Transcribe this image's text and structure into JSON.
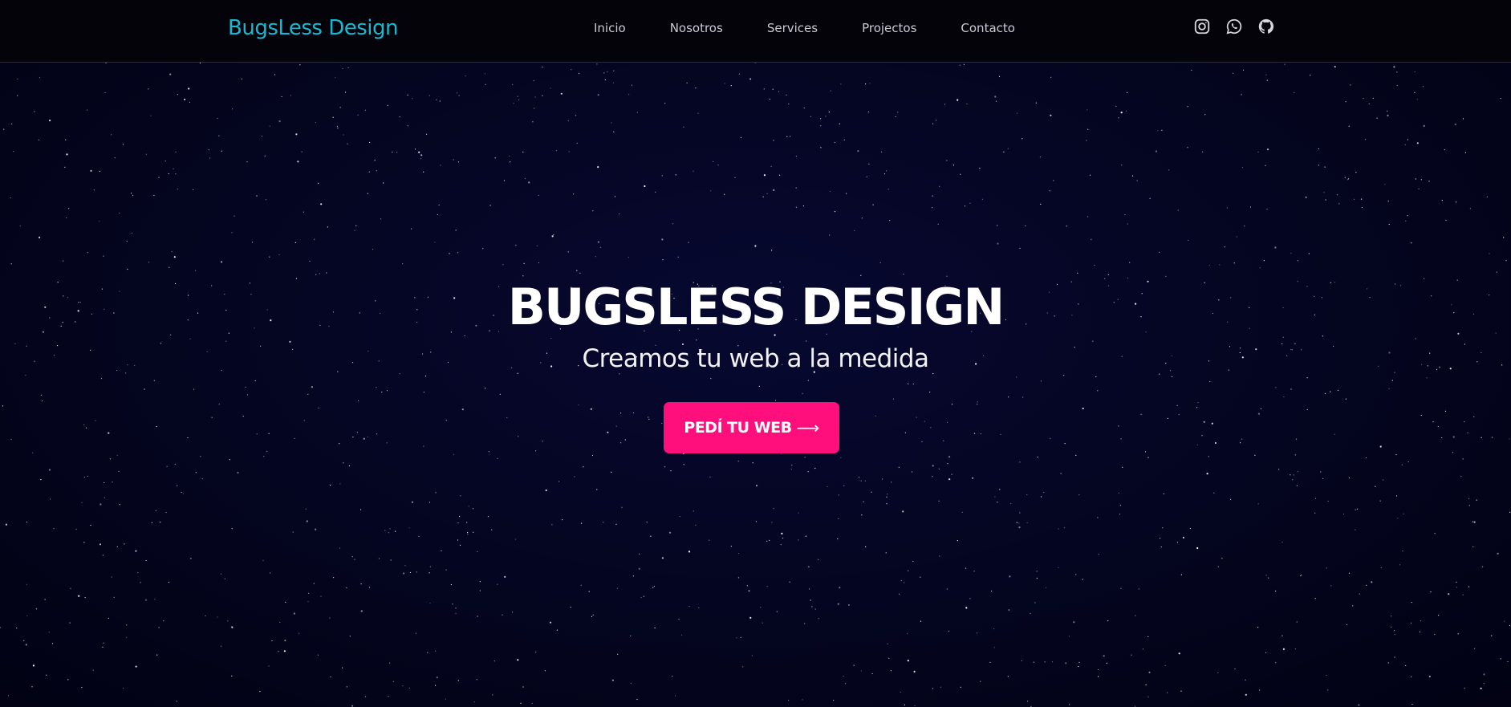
{
  "header": {
    "brand": "BugsLess Design",
    "nav": [
      {
        "label": "Inicio"
      },
      {
        "label": "Nosotros"
      },
      {
        "label": "Services"
      },
      {
        "label": "Projectos"
      },
      {
        "label": "Contacto"
      }
    ],
    "socials": [
      {
        "icon": "instagram-icon"
      },
      {
        "icon": "whatsapp-icon"
      },
      {
        "icon": "github-icon"
      }
    ]
  },
  "hero": {
    "title": "BUGSLESS DESIGN",
    "subtitle": "Creamos tu web a la medida",
    "cta_label": "PEDÍ TU WEB",
    "cta_arrow": "⟶"
  },
  "colors": {
    "brand": "#17b8d1",
    "accent": "#ff0f7b",
    "background": "#04051f",
    "navbar": "#030309"
  }
}
